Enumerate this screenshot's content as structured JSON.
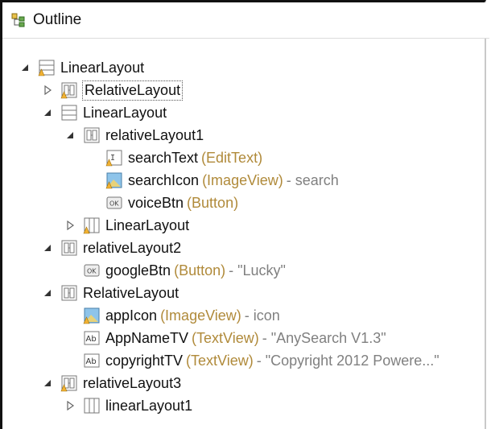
{
  "panel": {
    "title": "Outline"
  },
  "tree": [
    {
      "name": "LinearLayout",
      "type": "",
      "extra": "",
      "icon": "linear-layout-icon",
      "twisty": "expanded"
    },
    {
      "name": "RelativeLayout",
      "type": "",
      "extra": "",
      "icon": "relative-layout-icon",
      "twisty": "collapsed"
    },
    {
      "name": "LinearLayout",
      "type": "",
      "extra": "",
      "icon": "linear-layout-icon",
      "twisty": "expanded"
    },
    {
      "name": "relativeLayout1",
      "type": "",
      "extra": "",
      "icon": "relative-layout-icon",
      "twisty": "expanded"
    },
    {
      "name": "searchText",
      "type": "(EditText)",
      "extra": "",
      "icon": "edittext-icon",
      "twisty": "none"
    },
    {
      "name": "searchIcon",
      "type": "(ImageView)",
      "extra": "- search",
      "icon": "imageview-icon",
      "twisty": "none"
    },
    {
      "name": "voiceBtn",
      "type": "(Button)",
      "extra": "",
      "icon": "button-icon",
      "twisty": "none"
    },
    {
      "name": "LinearLayout",
      "type": "",
      "extra": "",
      "icon": "linear-layout-icon",
      "twisty": "collapsed"
    },
    {
      "name": "relativeLayout2",
      "type": "",
      "extra": "",
      "icon": "relative-layout-icon",
      "twisty": "expanded"
    },
    {
      "name": "googleBtn",
      "type": "(Button)",
      "extra": "- \"Lucky\"",
      "icon": "button-icon",
      "twisty": "none"
    },
    {
      "name": "RelativeLayout",
      "type": "",
      "extra": "",
      "icon": "relative-layout-icon",
      "twisty": "expanded"
    },
    {
      "name": "appIcon",
      "type": "(ImageView)",
      "extra": "- icon",
      "icon": "imageview-icon",
      "twisty": "none"
    },
    {
      "name": "AppNameTV",
      "type": "(TextView)",
      "extra": "- \"AnySearch V1.3\"",
      "icon": "textview-icon",
      "twisty": "none"
    },
    {
      "name": "copyrightTV",
      "type": "(TextView)",
      "extra": "- \"Copyright 2012 Powere...\"",
      "icon": "textview-icon",
      "twisty": "none"
    },
    {
      "name": "relativeLayout3",
      "type": "",
      "extra": "",
      "icon": "relative-layout-icon",
      "twisty": "expanded"
    },
    {
      "name": "linearLayout1",
      "type": "",
      "extra": "",
      "icon": "linear-layout-icon",
      "twisty": "collapsed"
    }
  ]
}
